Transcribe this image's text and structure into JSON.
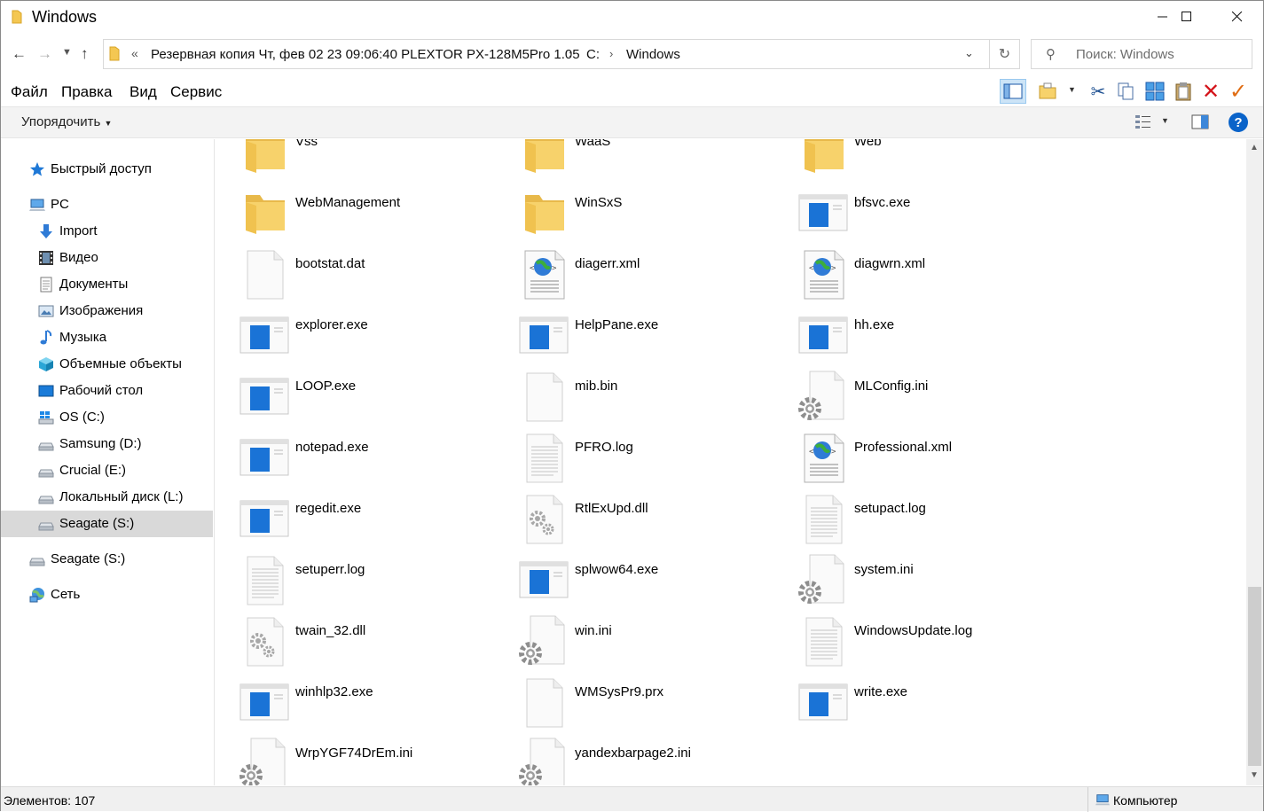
{
  "window": {
    "title": "Windows"
  },
  "navigation": {
    "address_overflow": "«",
    "breadcrumb": [
      "Резервная копия Чт, фев 02 23 09:06:40 PLEXTOR PX-128M5Pro 1.05",
      "C:",
      "Windows"
    ],
    "search_placeholder": "Поиск: Windows"
  },
  "menu": {
    "items": [
      "Файл",
      "Правка",
      "Вид",
      "Сервис"
    ]
  },
  "commandbar": {
    "organize_label": "Упорядочить"
  },
  "sidebar": {
    "items": [
      {
        "label": "Быстрый доступ",
        "icon": "star-icon"
      },
      {
        "label": "PC",
        "icon": "computer-icon"
      },
      {
        "label": "Import",
        "icon": "download-arrow-icon"
      },
      {
        "label": "Видео",
        "icon": "film-icon"
      },
      {
        "label": "Документы",
        "icon": "document-icon"
      },
      {
        "label": "Изображения",
        "icon": "pictures-icon"
      },
      {
        "label": "Музыка",
        "icon": "music-note-icon"
      },
      {
        "label": "Объемные объекты",
        "icon": "3d-cube-icon"
      },
      {
        "label": "Рабочий стол",
        "icon": "desktop-icon"
      },
      {
        "label": "OS (C:)",
        "icon": "windows-drive-icon"
      },
      {
        "label": "Samsung (D:)",
        "icon": "drive-icon"
      },
      {
        "label": "Crucial (E:)",
        "icon": "drive-icon"
      },
      {
        "label": "Локальный диск (L:)",
        "icon": "drive-icon"
      },
      {
        "label": "Seagate (S:)",
        "icon": "drive-icon"
      },
      {
        "label": "Seagate (S:)",
        "icon": "drive-icon"
      },
      {
        "label": "Сеть",
        "icon": "network-icon"
      }
    ]
  },
  "files": [
    {
      "name": "Vss",
      "type": "folder"
    },
    {
      "name": "WaaS",
      "type": "folder"
    },
    {
      "name": "Web",
      "type": "folder"
    },
    {
      "name": "WebManagement",
      "type": "folder"
    },
    {
      "name": "WinSxS",
      "type": "folder"
    },
    {
      "name": "bfsvc.exe",
      "type": "exe"
    },
    {
      "name": "bootstat.dat",
      "type": "blank"
    },
    {
      "name": "diagerr.xml",
      "type": "xml"
    },
    {
      "name": "diagwrn.xml",
      "type": "xml"
    },
    {
      "name": "explorer.exe",
      "type": "exe"
    },
    {
      "name": "HelpPane.exe",
      "type": "exe"
    },
    {
      "name": "hh.exe",
      "type": "exe"
    },
    {
      "name": "LOOP.exe",
      "type": "exe"
    },
    {
      "name": "mib.bin",
      "type": "blank"
    },
    {
      "name": "MLConfig.ini",
      "type": "ini"
    },
    {
      "name": "notepad.exe",
      "type": "exe"
    },
    {
      "name": "PFRO.log",
      "type": "log"
    },
    {
      "name": "Professional.xml",
      "type": "xml"
    },
    {
      "name": "regedit.exe",
      "type": "exe"
    },
    {
      "name": "RtlExUpd.dll",
      "type": "dll"
    },
    {
      "name": "setupact.log",
      "type": "log"
    },
    {
      "name": "setuperr.log",
      "type": "log"
    },
    {
      "name": "splwow64.exe",
      "type": "exe"
    },
    {
      "name": "system.ini",
      "type": "ini"
    },
    {
      "name": "twain_32.dll",
      "type": "dll"
    },
    {
      "name": "win.ini",
      "type": "ini"
    },
    {
      "name": "WindowsUpdate.log",
      "type": "log"
    },
    {
      "name": "winhlp32.exe",
      "type": "exe"
    },
    {
      "name": "WMSysPr9.prx",
      "type": "blank"
    },
    {
      "name": "write.exe",
      "type": "exe"
    },
    {
      "name": "WrpYGF74DrEm.ini",
      "type": "ini"
    },
    {
      "name": "yandexbarpage2.ini",
      "type": "ini"
    }
  ],
  "status": {
    "items_count": "Элементов: 107",
    "zone": "Компьютер"
  },
  "colors": {
    "selection": "#d9d9d9",
    "folder": "#f7d26b",
    "exe_blue": "#1a73d6",
    "accent": "#0a63c9"
  }
}
